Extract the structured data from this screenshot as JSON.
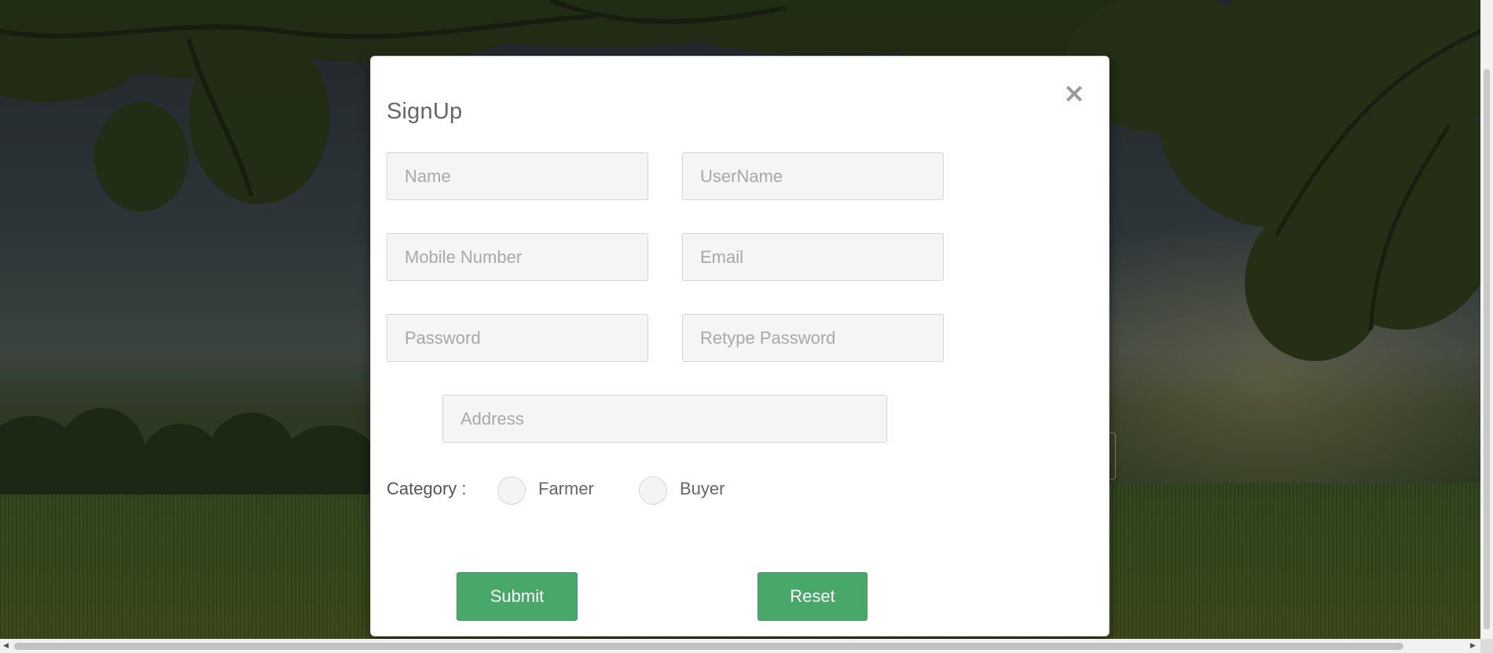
{
  "modal": {
    "title": "SignUp",
    "close_glyph": "×",
    "fields": {
      "name": "Name",
      "username": "UserName",
      "mobile": "Mobile Number",
      "email": "Email",
      "password": "Password",
      "retype_password": "Retype Password",
      "address": "Address"
    },
    "category": {
      "label": "Category :",
      "options": [
        "Farmer",
        "Buyer"
      ]
    },
    "buttons": {
      "submit": "Submit",
      "reset": "Reset"
    }
  },
  "icons": {
    "close": "close-icon",
    "scroll_left": "chevron-left-icon",
    "scroll_right": "chevron-right-icon",
    "scroll_up": "chevron-up-icon"
  },
  "colors": {
    "accent": "#47a86a",
    "input_bg": "#f5f5f5",
    "overlay": "rgba(0,0,0,.22)"
  }
}
